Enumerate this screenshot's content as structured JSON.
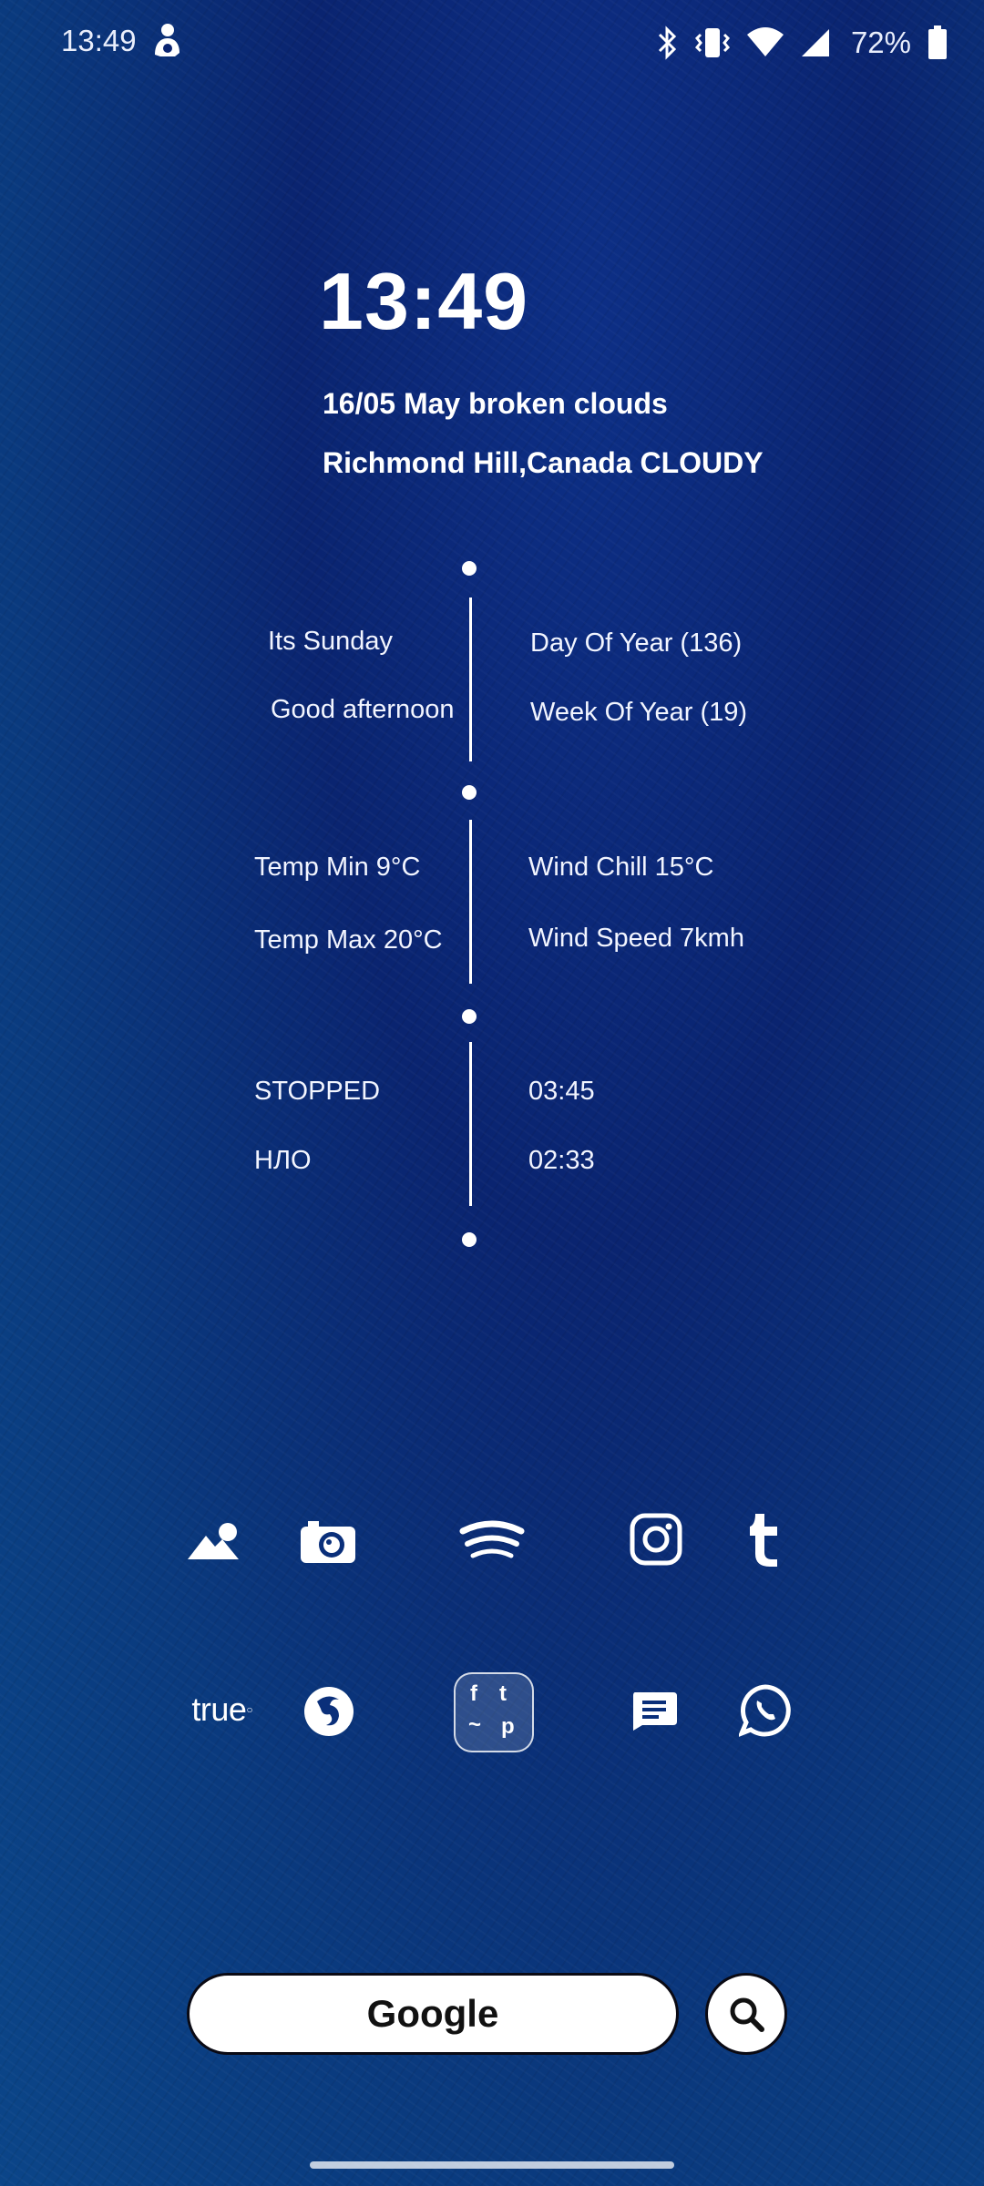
{
  "status_bar": {
    "time": "13:49",
    "battery_percent": "72%",
    "icons": [
      "assistant-icon",
      "bluetooth-icon",
      "vibrate-icon",
      "wifi-icon",
      "signal-icon",
      "battery-icon"
    ]
  },
  "clock": {
    "time": "13:49",
    "date_weather": "16/05 May broken clouds",
    "location_condition": "Richmond Hill,Canada CLOUDY"
  },
  "info": {
    "day_name": "Its Sunday",
    "greeting": "Good afternoon",
    "day_of_year": "Day Of Year (136)",
    "week_of_year": "Week Of Year (19)",
    "temp_min": "Temp Min 9°C",
    "temp_max": "Temp Max 20°C",
    "wind_chill": "Wind Chill 15°C",
    "wind_speed": "Wind Speed 7kmh",
    "media_status": "STOPPED",
    "media_title": "НЛО",
    "media_position": "03:45",
    "media_duration": "02:33"
  },
  "apps_row1": [
    "gallery-icon",
    "camera-icon",
    "spotify-icon",
    "instagram-icon",
    "tumblr-icon"
  ],
  "apps_row2": {
    "truecaller_label": "true",
    "folder_letters": [
      "f",
      "t",
      "~",
      "p"
    ]
  },
  "search": {
    "label": "Google"
  },
  "colors": {
    "background": "#0a2470",
    "text": "#ffffff"
  }
}
